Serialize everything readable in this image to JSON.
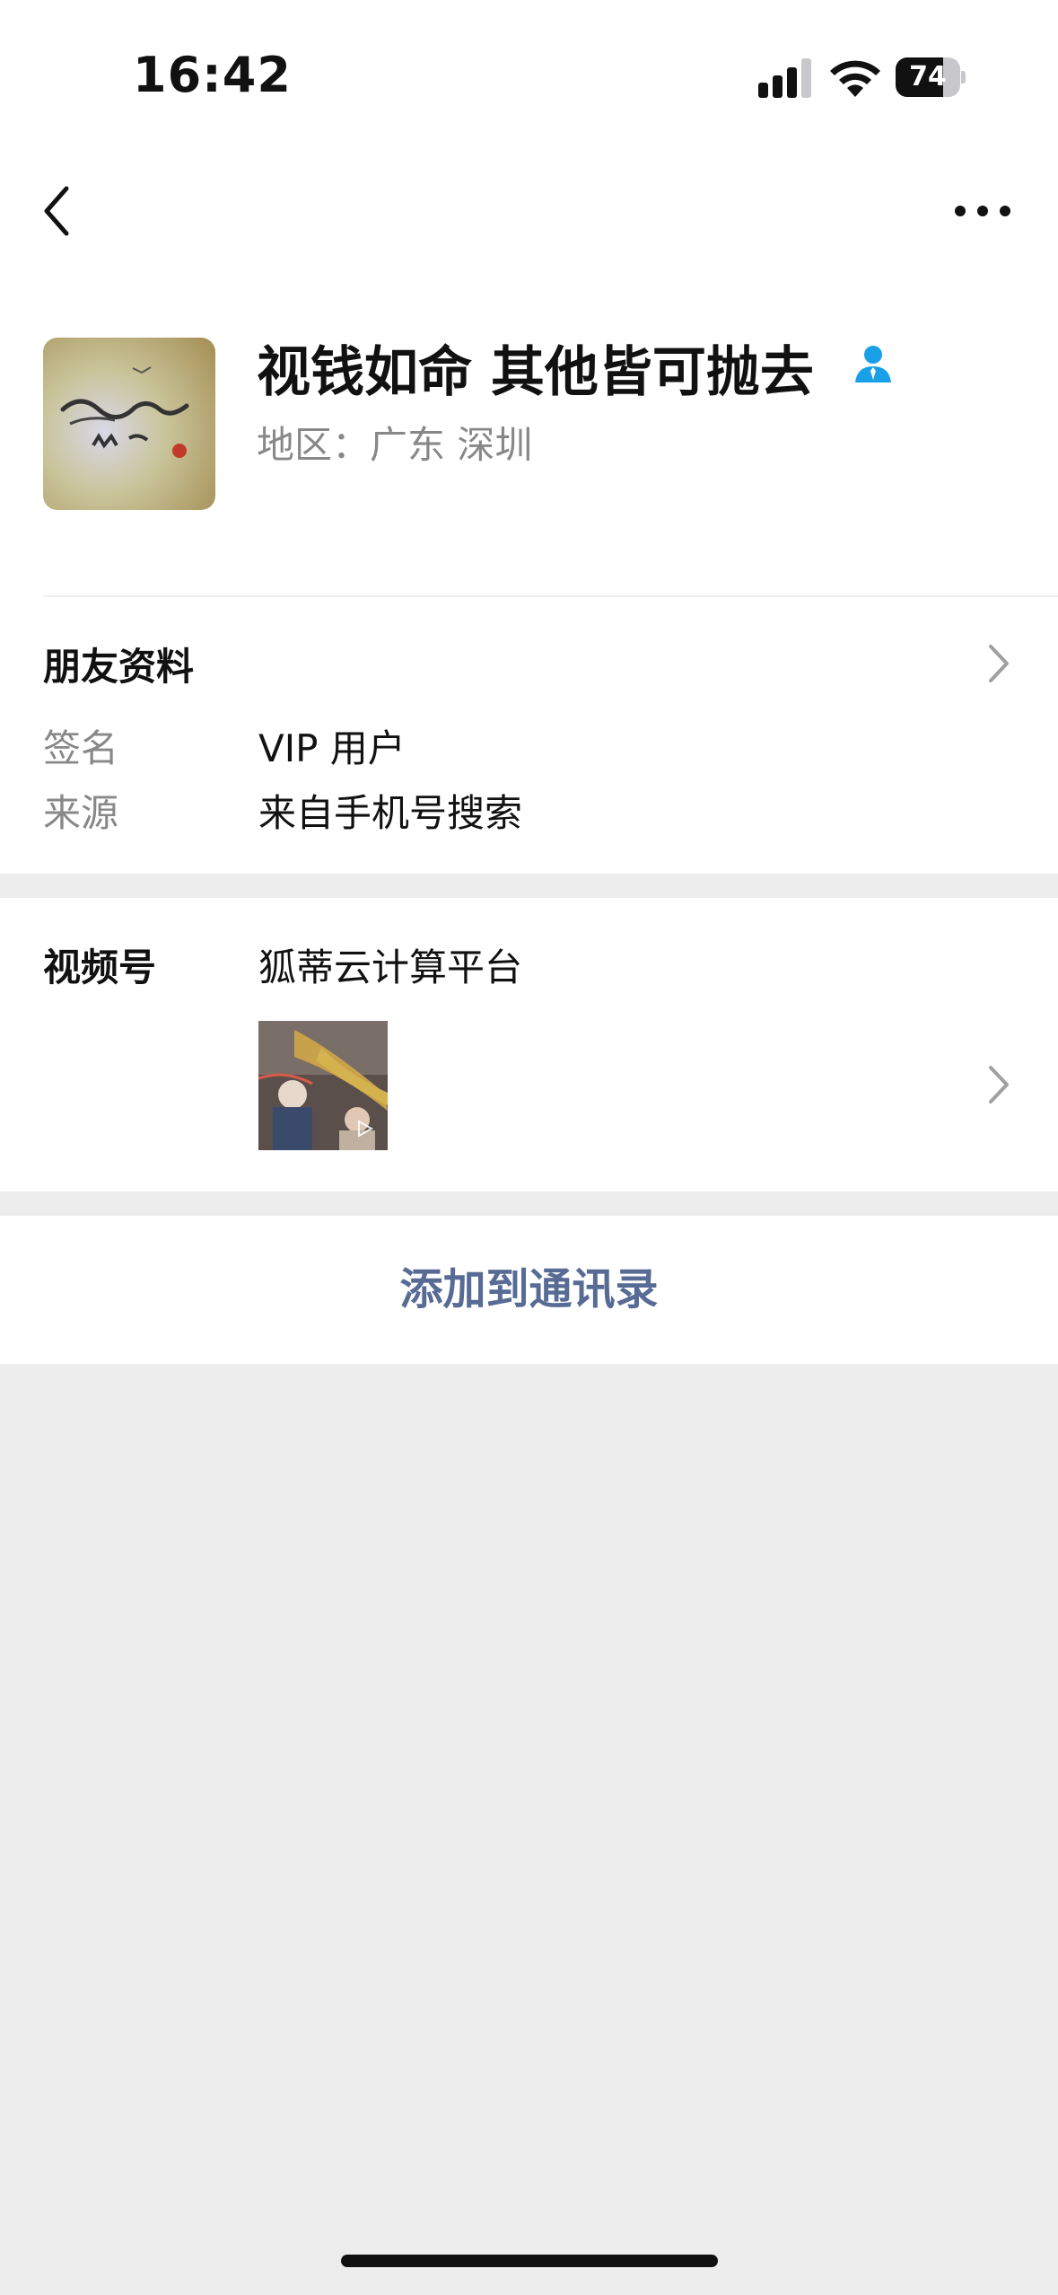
{
  "status_bar": {
    "time": "16:42",
    "battery": "74",
    "battery_level": 0.74
  },
  "nav": {
    "back_icon": "chevron-left-icon",
    "more_icon": "more-horizontal-icon"
  },
  "profile": {
    "nickname": "视钱如命 其他皆可抛去",
    "region": "地区：广东 深圳",
    "verified_icon": "person-icon",
    "verified_color": "#1aa0e6"
  },
  "friend_info": {
    "title": "朋友资料",
    "rows": [
      {
        "label": "签名",
        "value": "VIP 用户"
      },
      {
        "label": "来源",
        "value": "来自手机号搜索"
      }
    ]
  },
  "channels": {
    "label": "视频号",
    "name": "狐蒂云计算平台",
    "thumb_icon": "play-icon"
  },
  "actions": {
    "add_contact": "添加到通讯录",
    "link_color": "#576b95"
  },
  "colors": {
    "background": "#ededed",
    "surface": "#ffffff",
    "secondary_text": "#888888"
  }
}
